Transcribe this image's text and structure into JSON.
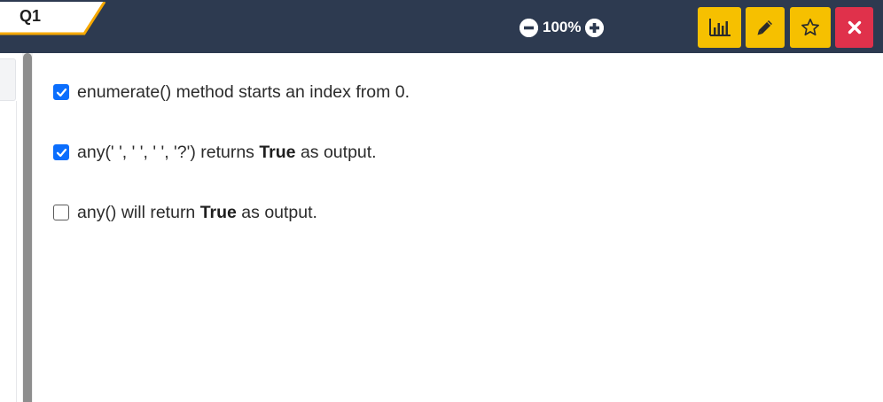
{
  "header": {
    "question_tab": "Q1",
    "zoom": {
      "value": "100%",
      "minus_icon": "minus-circle-icon",
      "plus_icon": "plus-circle-icon"
    },
    "buttons": [
      {
        "name": "stats",
        "icon": "bar-chart-icon",
        "color": "#f6c000"
      },
      {
        "name": "edit",
        "icon": "pencil-icon",
        "color": "#f6c000"
      },
      {
        "name": "favorite",
        "icon": "star-icon",
        "color": "#f6c000"
      },
      {
        "name": "close",
        "icon": "close-icon",
        "color": "#e0314b"
      }
    ],
    "background": "#2d3a50",
    "accent": "#f6a800"
  },
  "options": [
    {
      "checked": true,
      "pre": "enumerate() method starts an index from 0.",
      "bold": "",
      "post": ""
    },
    {
      "checked": true,
      "pre": "any(' ', ' ', ' ', '?') returns ",
      "bold": "True",
      "post": " as output."
    },
    {
      "checked": false,
      "pre": "any() will return ",
      "bold": "True",
      "post": " as output."
    }
  ]
}
